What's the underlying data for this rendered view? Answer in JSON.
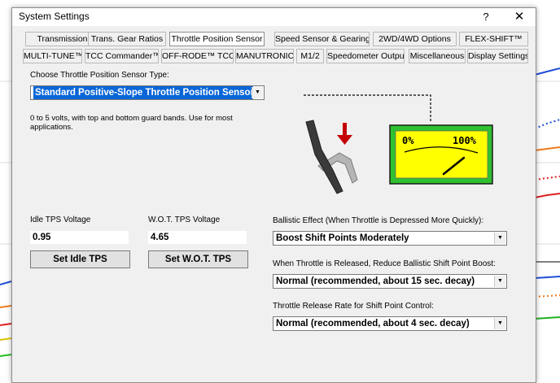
{
  "window": {
    "title": "System Settings",
    "help_glyph": "?",
    "close_glyph": "✕"
  },
  "tabs_row1": [
    {
      "label": "Transmission"
    },
    {
      "label": "Trans. Gear Ratios"
    },
    {
      "label": "Throttle Position Sensor",
      "active": true
    },
    {
      "label": "Speed Sensor & Gearing"
    },
    {
      "label": "2WD/4WD Options"
    },
    {
      "label": "FLEX-SHIFT™"
    }
  ],
  "tabs_row2": [
    {
      "label": "MULTI-TUNE™"
    },
    {
      "label": "TCC Commander™"
    },
    {
      "label": "OFF-RODE™ TCC"
    },
    {
      "label": "MANUTRONIC"
    },
    {
      "label": "M1/2"
    },
    {
      "label": "Speedometer Output"
    },
    {
      "label": "Miscellaneous"
    },
    {
      "label": "Display Settings"
    }
  ],
  "sensor_type": {
    "label": "Choose Throttle Position Sensor Type:",
    "value": "Standard Positive-Slope Throttle Position Sensor",
    "description": "0 to 5 volts, with top and bottom guard bands. Use for most applications."
  },
  "gauge": {
    "min_label": "0%",
    "max_label": "100%"
  },
  "idle_tps": {
    "label": "Idle TPS Voltage",
    "value": "0.95",
    "button": "Set Idle TPS"
  },
  "wot_tps": {
    "label": "W.O.T. TPS Voltage",
    "value": "4.65",
    "button": "Set W.O.T. TPS"
  },
  "ballistic": {
    "label": "Ballistic Effect (When Throttle is Depressed More Quickly):",
    "value": "Boost Shift Points Moderately"
  },
  "release_reduce": {
    "label": "When Throttle is Released, Reduce Ballistic Shift Point Boost:",
    "value": "Normal (recommended, about 15 sec. decay)"
  },
  "release_rate": {
    "label": "Throttle Release Rate for Shift Point Control:",
    "value": "Normal (recommended, about 4 sec. decay)"
  },
  "colors": {
    "dialog_bg": "#f0f0f0",
    "gauge_green": "#2fc12f",
    "gauge_yellow": "#ffff00",
    "arrow_red": "#c40000",
    "selection_blue": "#0a66d8"
  }
}
